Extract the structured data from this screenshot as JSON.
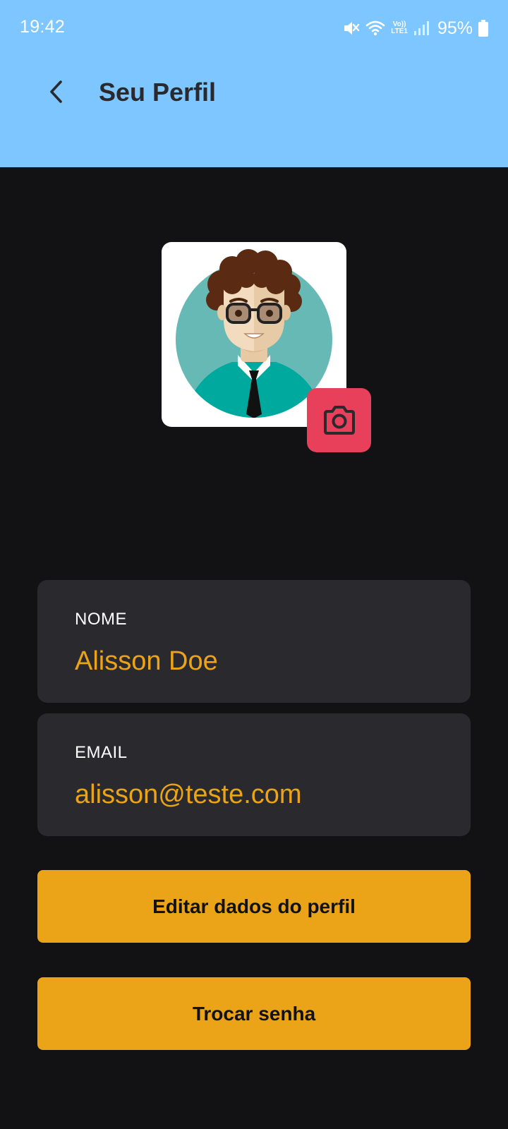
{
  "status_bar": {
    "time": "19:42",
    "battery_percent": "95%",
    "network_label_top": "Vo))",
    "network_label_bottom": "LTE1",
    "icons": [
      "mute-icon",
      "wifi-icon",
      "signal-icon",
      "battery-icon"
    ]
  },
  "header": {
    "title": "Seu Perfil",
    "back_icon": "chevron-left-icon"
  },
  "avatar": {
    "camera_icon": "camera-icon"
  },
  "fields": [
    {
      "label": "NOME",
      "value": "Alisson Doe"
    },
    {
      "label": "EMAIL",
      "value": "alisson@teste.com"
    }
  ],
  "buttons": {
    "edit_profile": "Editar dados do perfil",
    "change_password": "Trocar senha"
  },
  "colors": {
    "header_bg": "#7DC6FF",
    "page_bg": "#121214",
    "card_bg": "#29292E",
    "accent": "#EBA417",
    "camera_bg": "#E83F5B"
  }
}
